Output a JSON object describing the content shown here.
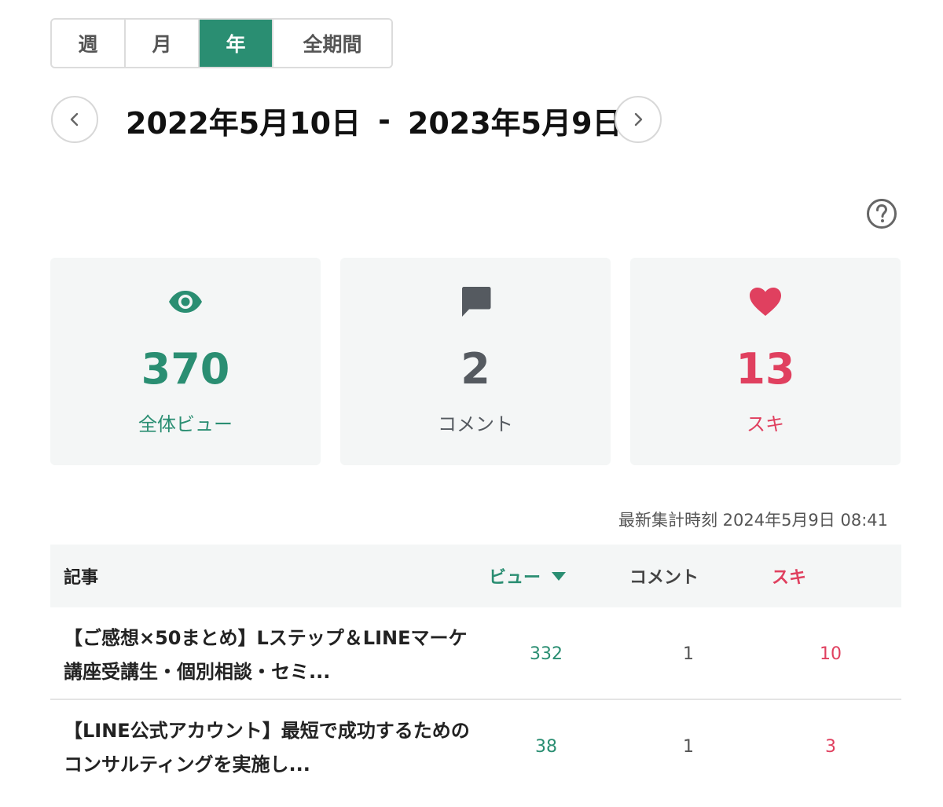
{
  "period_tabs": [
    {
      "label": "週"
    },
    {
      "label": "月"
    },
    {
      "label": "年"
    },
    {
      "label": "全期間"
    }
  ],
  "active_tab": "年",
  "date_range": {
    "start": "2022年5月10日",
    "separator": "-",
    "end": "2023年5月9日"
  },
  "stats": {
    "views": {
      "value": "370",
      "label": "全体ビュー",
      "color": "#2a8e72",
      "icon": "eye-icon"
    },
    "comments": {
      "value": "2",
      "label": "コメント",
      "color": "#555a60",
      "icon": "comment-icon"
    },
    "likes": {
      "value": "13",
      "label": "スキ",
      "color": "#e0405f",
      "icon": "heart-icon"
    }
  },
  "updated_at": "最新集計時刻 2024年5月9日 08:41",
  "table": {
    "headers": {
      "article": "記事",
      "views": "ビュー",
      "comments": "コメント",
      "likes": "スキ"
    },
    "rows": [
      {
        "title": "【ご感想×50まとめ】Lステップ＆LINEマーケ講座受講生・個別相談・セミ...",
        "views": "332",
        "comments": "1",
        "likes": "10"
      },
      {
        "title": "【LINE公式アカウント】最短で成功するためのコンサルティングを実施し...",
        "views": "38",
        "comments": "1",
        "likes": "3"
      }
    ]
  }
}
